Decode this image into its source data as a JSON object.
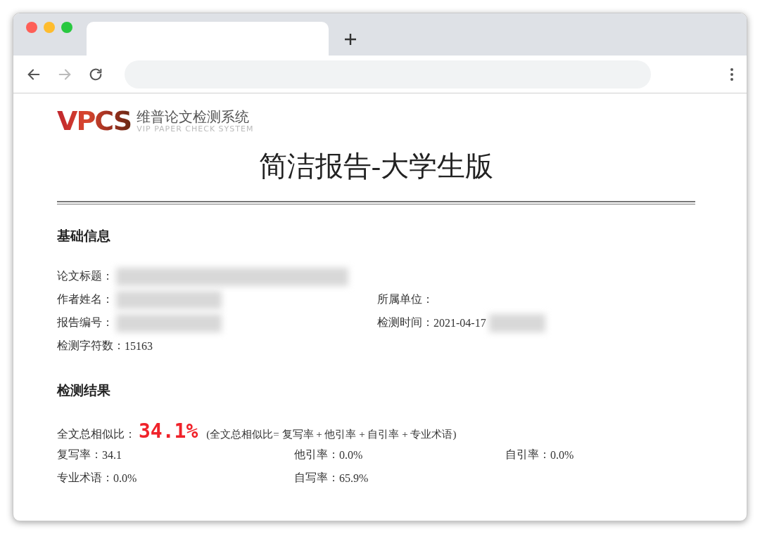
{
  "browser": {
    "tabs": [
      {
        "selected": true
      }
    ],
    "forward_enabled": false
  },
  "report": {
    "logo": {
      "mark": "VPCS",
      "name": "维普论文检测系统",
      "tagline": "VIP PAPER CHECK SYSTEM"
    },
    "title": "简洁报告-大学生版",
    "basic": {
      "heading": "基础信息",
      "rows": [
        [
          {
            "label": "论文标题：",
            "blurred": true
          }
        ],
        [
          {
            "label": "作者姓名：",
            "blurred": true
          },
          {
            "label": "所属单位："
          }
        ],
        [
          {
            "label": "报告编号：",
            "blurred": true
          },
          {
            "label": "检测时间：",
            "value": "2021-04-17",
            "blurred": true
          }
        ],
        [
          {
            "label": "检测字符数：",
            "value": "15163"
          }
        ]
      ]
    },
    "results": {
      "heading": "检测结果",
      "total_label": "全文总相似比：",
      "total_value": "34.1%",
      "formula": "(全文总相似比= 复写率 + 他引率 + 自引率 + 专业术语)",
      "rows": [
        [
          {
            "label": "复写率：",
            "value": "34.1"
          },
          {
            "label": "他引率：",
            "value": "0.0%"
          },
          {
            "label": "自引率：",
            "value": "0.0%"
          }
        ],
        [
          {
            "label": "专业术语：",
            "value": "0.0%"
          },
          {
            "label": "自写率：",
            "value": "65.9%"
          }
        ]
      ]
    }
  }
}
